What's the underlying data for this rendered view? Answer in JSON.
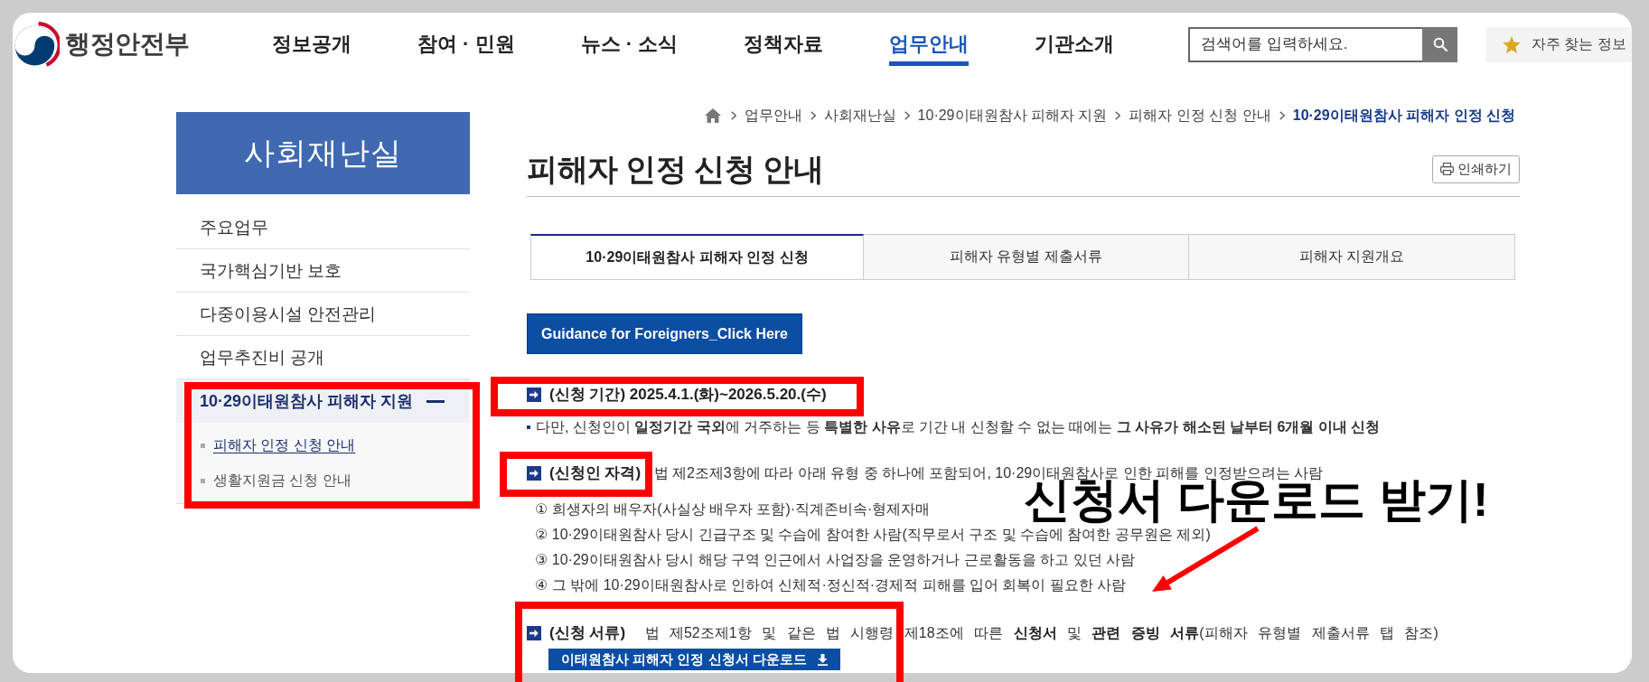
{
  "header": {
    "logo_text": "행정안전부",
    "nav": [
      {
        "label": "정보공개",
        "selected": false
      },
      {
        "label": "참여 · 민원",
        "selected": false
      },
      {
        "label": "뉴스 · 소식",
        "selected": false
      },
      {
        "label": "정책자료",
        "selected": false
      },
      {
        "label": "업무안내",
        "selected": true
      },
      {
        "label": "기관소개",
        "selected": false
      }
    ],
    "search": {
      "placeholder": "검색어를 입력하세요."
    },
    "favorites": "자주 찾는 정보"
  },
  "sidebar": {
    "title": "사회재난실",
    "items": [
      {
        "label": "주요업무",
        "expanded": false
      },
      {
        "label": "국가핵심기반 보호",
        "expanded": false
      },
      {
        "label": "다중이용시설 안전관리",
        "expanded": false
      },
      {
        "label": "업무추진비 공개",
        "expanded": false
      },
      {
        "label": "10·29이태원참사 피해자 지원",
        "expanded": true,
        "children": [
          {
            "label": "피해자 인정 신청 안내",
            "selected": true
          },
          {
            "label": "생활지원금 신청 안내",
            "selected": false
          }
        ]
      }
    ]
  },
  "breadcrumb": [
    "업무안내",
    "사회재난실",
    "10·29이태원참사 피해자 지원",
    "피해자 인정 신청 안내",
    "10·29이태원참사 피해자 인정 신청"
  ],
  "page_title": "피해자 인정 신청 안내",
  "print_button": "인쇄하기",
  "tabs": [
    {
      "label": "10·29이태원참사 피해자 인정 신청",
      "selected": true
    },
    {
      "label": "피해자 유형별 제출서류",
      "selected": false
    },
    {
      "label": "피해자 지원개요",
      "selected": false
    }
  ],
  "guidance_button": "Guidance for Foreigners_Click Here",
  "sections": [
    {
      "label": "(신청 기간) 2025.4.1.(화)~2026.5.20.(수)",
      "note": "다만, 신청인이 **일정기간 국외**에 거주하는 등 **특별한 사유**로 기간 내 신청할 수 없는 때에는 **그 사유가 해소된 날부터 6개월 이내 신청**"
    },
    {
      "label": "(신청인 자격)",
      "text": "법 제2조제3항에 따라 아래 유형 중 하나에 포함되어, 10·29이태원참사로 인한 피해를 인정받으려는 사람",
      "items": [
        "① 희생자의 배우자(사실상 배우자 포함)·직계존비속·형제자매",
        "② 10·29이태원참사 당시 긴급구조 및 수습에 참여한 사람(직무로서 구조 및 수습에 참여한 공무원은 제외)",
        "③ 10·29이태원참사 당시 해당 구역 인근에서 사업장을 운영하거나 근로활동을 하고 있던 사람",
        "④ 그 밖에 10·29이태원참사로 인하여 신체적·정신적·경제적 피해를 입어 회복이 필요한 사람"
      ]
    },
    {
      "label": "(신청 서류)",
      "text": "법 제52조제1항 및 같은 법 시행령 제18조에 따른 **신청서** 및 **관련 증빙 서류**(피해자 유형별 제출서류 탭 참조)",
      "download_button": "이태원참사 피해자 인정 신청서 다운로드"
    }
  ],
  "annotation": {
    "callout": "신청서 다운로드 받기!"
  }
}
